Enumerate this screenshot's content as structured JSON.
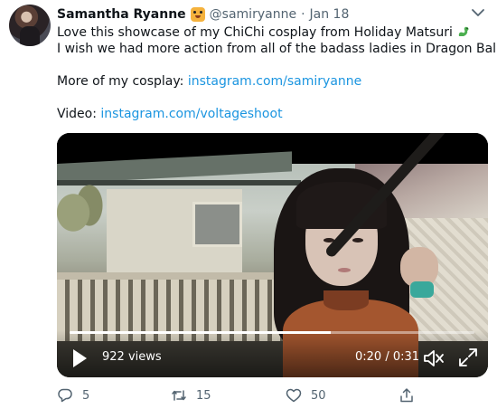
{
  "tweet": {
    "author_name": "Samantha Ryanne",
    "author_handle": "@samiryanne",
    "separator": "·",
    "date": "Jan 18",
    "lines": {
      "line1": "Love this showcase of my ChiChi cosplay from Holiday Matsuri",
      "line2": "I wish we had more action from all of the badass ladies in Dragon Ball!",
      "cosplay_prefix": "More of my cosplay: ",
      "cosplay_link": "instagram.com/samiryanne",
      "video_prefix": "Video: ",
      "video_link": "instagram.com/voltageshoot"
    },
    "icons": {
      "badge": "tiger-face-emoji-icon",
      "dragon": "dragon-emoji-icon",
      "menu": "chevron-down-icon"
    }
  },
  "video": {
    "views": "922 views",
    "time": "0:20 / 0:31",
    "progress": 0.645,
    "icons": {
      "play": "play-icon",
      "volume": "volume-muted-icon",
      "fullscreen": "fullscreen-icon"
    }
  },
  "actions": {
    "reply_count": "5",
    "retweet_count": "15",
    "like_count": "50"
  },
  "colors": {
    "link": "#1b95e0",
    "text": "#0f1419",
    "muted": "#536471"
  }
}
